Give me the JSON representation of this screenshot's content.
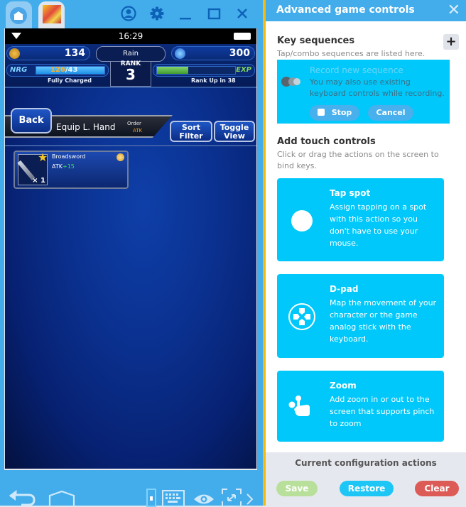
{
  "emulator": {
    "tabs": [
      {
        "name": "home",
        "icon": "home-icon"
      },
      {
        "name": "game",
        "icon": "game-thumbnail"
      }
    ],
    "titlebar_icons": [
      "account-icon",
      "gear-icon",
      "minimize-icon",
      "maximize-icon",
      "close-icon"
    ],
    "status_bar": {
      "time": "16:29"
    },
    "hud": {
      "gil": "134",
      "weather": "Rain",
      "gems": "300",
      "rank_label": "RANK",
      "rank": "3",
      "nrg_label": "NRG",
      "nrg_current": "126",
      "nrg_max": "/43",
      "nrg_fill_percent": 100,
      "nrg_status": "Fully Charged",
      "exp_label": "EXP",
      "exp_fill_percent": 40,
      "rank_up_text": "Rank Up in 38"
    },
    "equip_header": {
      "back_label": "Back",
      "title": "Equip L. Hand",
      "order_label": "Order",
      "order_value": "ATK",
      "sort_filter_label": [
        "Sort",
        "Filter"
      ],
      "toggle_view_label": [
        "Toggle",
        "View"
      ]
    },
    "items": [
      {
        "name": "Broadsword",
        "rarity": "1",
        "stat_label": "ATK",
        "stat_bonus": "+15",
        "quantity": "× 1"
      }
    ],
    "navbar_icons": [
      "back-icon",
      "home-icon",
      "screen-icon",
      "keyboard-icon",
      "eye-icon",
      "fullscreen-icon",
      "chevron-right-icon"
    ]
  },
  "panel": {
    "title": "Advanced game controls",
    "key_sequences": {
      "title": "Key sequences",
      "subtitle": "Tap/combo sequences are listed here.",
      "add_label": "+",
      "record_title": "Record new sequence",
      "record_desc": "You may also use existing keyboard controls while recording.",
      "stop_label": "Stop",
      "cancel_label": "Cancel"
    },
    "touch_controls": {
      "title": "Add touch controls",
      "subtitle": "Click or drag the actions on the screen to bind keys.",
      "cards": [
        {
          "title": "Tap spot",
          "desc": "Assign tapping on a spot with this action so you don't have to use your mouse."
        },
        {
          "title": "D-pad",
          "desc": "Map the movement of your character or the game analog stick with the keyboard."
        },
        {
          "title": "Zoom",
          "desc": "Add zoom in or out to the screen that supports pinch to zoom"
        }
      ]
    },
    "config": {
      "title": "Current configuration actions",
      "save_label": "Save",
      "restore_label": "Restore",
      "clear_label": "Clear"
    }
  },
  "colors": {
    "titlebar": "#43aceb",
    "accent_cyan": "#00c8fa",
    "panel_border": "#f6b90d",
    "save": "#b8e09a",
    "restore": "#1ec6f6",
    "clear": "#dd5b56"
  }
}
